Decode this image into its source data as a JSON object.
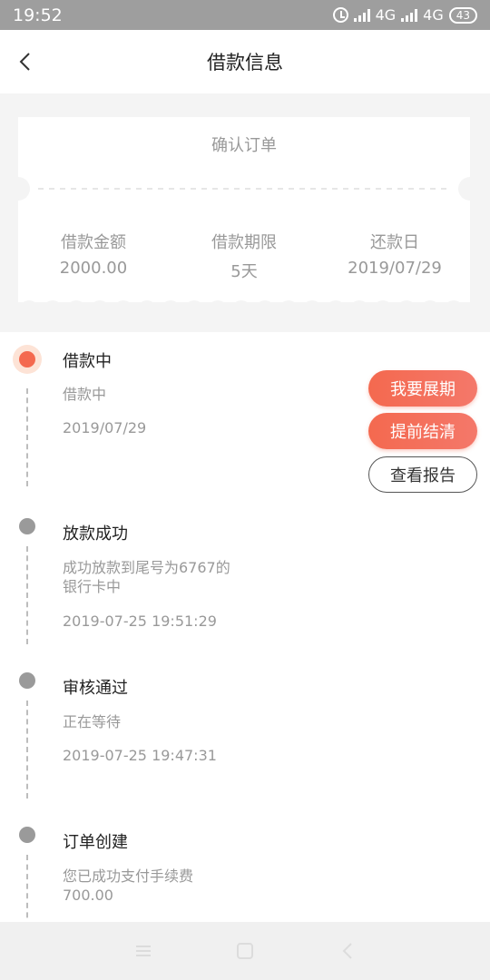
{
  "status_bar": {
    "time": "19:52",
    "network_1": "4G",
    "network_2": "4G",
    "battery": "43"
  },
  "header": {
    "title": "借款信息",
    "back_icon": "chevron-left-icon"
  },
  "ticket": {
    "heading": "确认订单",
    "fields": [
      {
        "label": "借款金额",
        "value": "2000.00"
      },
      {
        "label": "借款期限",
        "value": "5天"
      },
      {
        "label": "还款日",
        "value": "2019/07/29"
      }
    ]
  },
  "timeline": [
    {
      "name": "借款中",
      "desc": "借款中",
      "time": "2019/07/29",
      "active": true
    },
    {
      "name": "放款成功",
      "desc": "成功放款到尾号为6767的银行卡中",
      "time": "2019-07-25 19:51:29",
      "active": false
    },
    {
      "name": "审核通过",
      "desc": "正在等待",
      "time": "2019-07-25 19:47:31",
      "active": false
    },
    {
      "name": "订单创建",
      "desc": "您已成功支付手续费700.00",
      "time": "",
      "active": false
    }
  ],
  "actions": {
    "extend": "我要展期",
    "early_repay": "提前结清",
    "view_report": "查看报告"
  },
  "colors": {
    "accent": "#f4694f",
    "muted": "#999999",
    "dot_inactive": "#9a9a9a"
  }
}
